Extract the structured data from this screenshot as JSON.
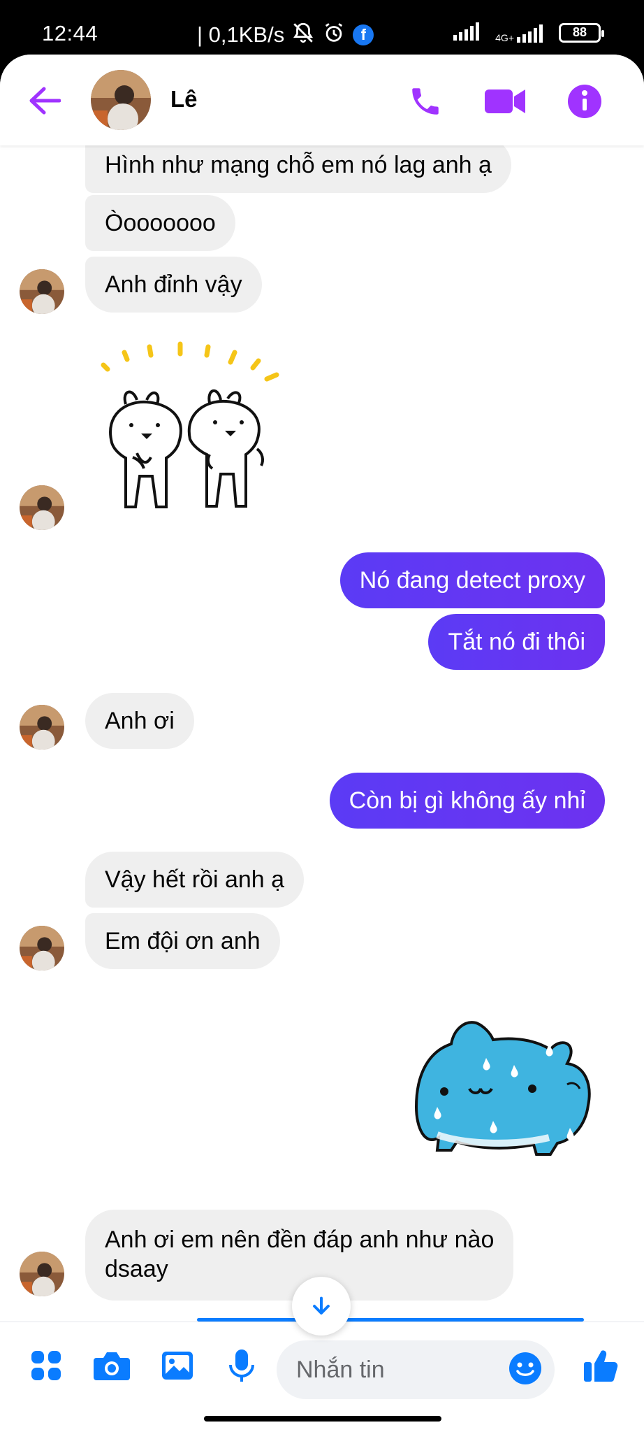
{
  "status_bar": {
    "time": "12:44",
    "speed": "| 0,1KB/s",
    "network_label": "4G+",
    "battery": "88"
  },
  "header": {
    "contact_name": "Lê",
    "accent_color": "#a033ff"
  },
  "messages": [
    {
      "side": "in",
      "text": "Hình như mạng chỗ em nó lag anh ạ"
    },
    {
      "side": "in",
      "text": "Òooooooo"
    },
    {
      "side": "in",
      "text": "Anh đỉnh vậy"
    },
    {
      "side": "in",
      "sticker": "two-rabbits-sticker"
    },
    {
      "side": "out",
      "text": "Nó đang detect proxy"
    },
    {
      "side": "out",
      "text": "Tắt nó đi thôi"
    },
    {
      "side": "in",
      "text": "Anh ơi"
    },
    {
      "side": "out",
      "text": "Còn bị gì không ấy nhỉ"
    },
    {
      "side": "in",
      "text": "Vậy hết rồi anh ạ"
    },
    {
      "side": "in",
      "text": "Em đội ơn anh"
    },
    {
      "side": "out",
      "sticker": "blue-cat-sweating-sticker"
    },
    {
      "side": "in",
      "text_line1": "Anh ơi em nên đền đáp anh như nào",
      "text_line2": "dsaay"
    }
  ],
  "composer": {
    "placeholder": "Nhắn tin",
    "brand_color": "#0a7cff"
  }
}
